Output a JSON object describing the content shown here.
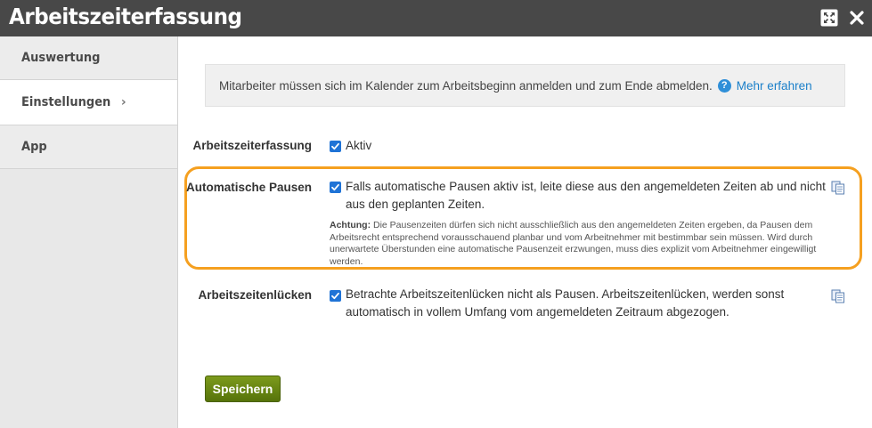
{
  "window": {
    "title": "Arbeitszeiterfassung",
    "expand_icon": "expand-icon",
    "close_icon": "close-icon"
  },
  "sidebar": {
    "items": [
      {
        "label": "Auswertung",
        "active": false
      },
      {
        "label": "Einstellungen",
        "active": true,
        "chevron": "›"
      },
      {
        "label": "App",
        "active": false
      }
    ]
  },
  "info": {
    "text": "Mitarbeiter müssen sich im Kalender zum Arbeitsbeginn anmelden und zum Ende abmelden.",
    "help_icon": "?",
    "link": "Mehr erfahren"
  },
  "settings": {
    "arbeitszeiterfassung": {
      "label": "Arbeitszeiterfassung",
      "checked": true,
      "text": "Aktiv"
    },
    "automatische_pausen": {
      "label": "Automatische Pausen",
      "checked": true,
      "text_line1": "Falls automatische Pausen aktiv ist, leite diese aus den angemeldeten Zeiten ab und nicht",
      "text_line2": "aus den geplanten Zeiten.",
      "warning_label": "Achtung:",
      "warning_line1": "Die Pausenzeiten dürfen sich nicht ausschließlich aus den angemeldeten Zeiten ergeben, da Pausen dem",
      "warning_line2": "Arbeitsrecht entsprechend vorausschauend planbar und vom Arbeitnehmer mit bestimmbar sein müssen. Wird durch",
      "warning_line3": "unerwartete Überstunden eine automatische Pausenzeit erzwungen, muss dies explizit vom Arbeitnehmer eingewilligt",
      "warning_line4": "werden."
    },
    "arbeitszeitenluecken": {
      "label": "Arbeitszeitenlücken",
      "checked": true,
      "text_line1": "Betrachte Arbeitszeitenlücken nicht als Pausen. Arbeitszeitenlücken, werden sonst",
      "text_line2": "automatisch in vollem Umfang vom angemeldeten Zeitraum abgezogen."
    }
  },
  "save_label": "Speichern",
  "colors": {
    "titlebar": "#484848",
    "highlight": "#f5a020",
    "checkbox": "#1f73d6",
    "link": "#1a7fc9",
    "save": "#6a8714"
  }
}
